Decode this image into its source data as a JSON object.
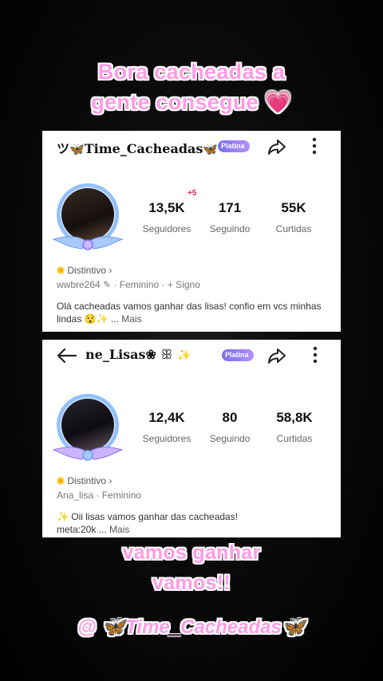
{
  "captions": {
    "top_line1": "Bora cacheadas a",
    "top_line2": "gente consegue",
    "top_heart": "💗",
    "mid_line1": "vamos ganhar",
    "mid_line2": "vamos!!",
    "handle": "@ 🦋Time_Cacheadas🦋"
  },
  "profile1": {
    "username_prefix": "ツ",
    "username": "Time_Cacheadas",
    "butterfly": "🦋",
    "platina_label": "Platina",
    "followers_badge": "+5",
    "stats": [
      {
        "value": "13,5K",
        "label": "Seguidores"
      },
      {
        "value": "171",
        "label": "Seguindo"
      },
      {
        "value": "55K",
        "label": "Curtidas"
      }
    ],
    "distintivo": "Distintivo",
    "meta_id": "wwbre264",
    "meta_gender": "Feminino",
    "meta_sign": "+ Signo",
    "bio": "Olá cacheadas vamos ganhar das lisas! confio em vcs minhas lindas 😯✨ ...",
    "mais": "Mais"
  },
  "profile2": {
    "username": "ne_Lisas❀",
    "decoration": "✨",
    "platina_label": "Platina",
    "stats": [
      {
        "value": "12,4K",
        "label": "Seguidores"
      },
      {
        "value": "80",
        "label": "Seguindo"
      },
      {
        "value": "58,8K",
        "label": "Curtidas"
      }
    ],
    "distintivo": "Distintivo",
    "meta_id": "Ana_lisa",
    "meta_gender": "Feminino",
    "bio_line1": "✨ Oii lisas vamos ganhar das cacheadas!",
    "bio_line2": "meta:20k ...",
    "mais": "Mais"
  },
  "colors": {
    "caption_pink": "#ff9be4",
    "platina_purple": "#8a74f5",
    "ring_blue": "#8ec2ff"
  }
}
